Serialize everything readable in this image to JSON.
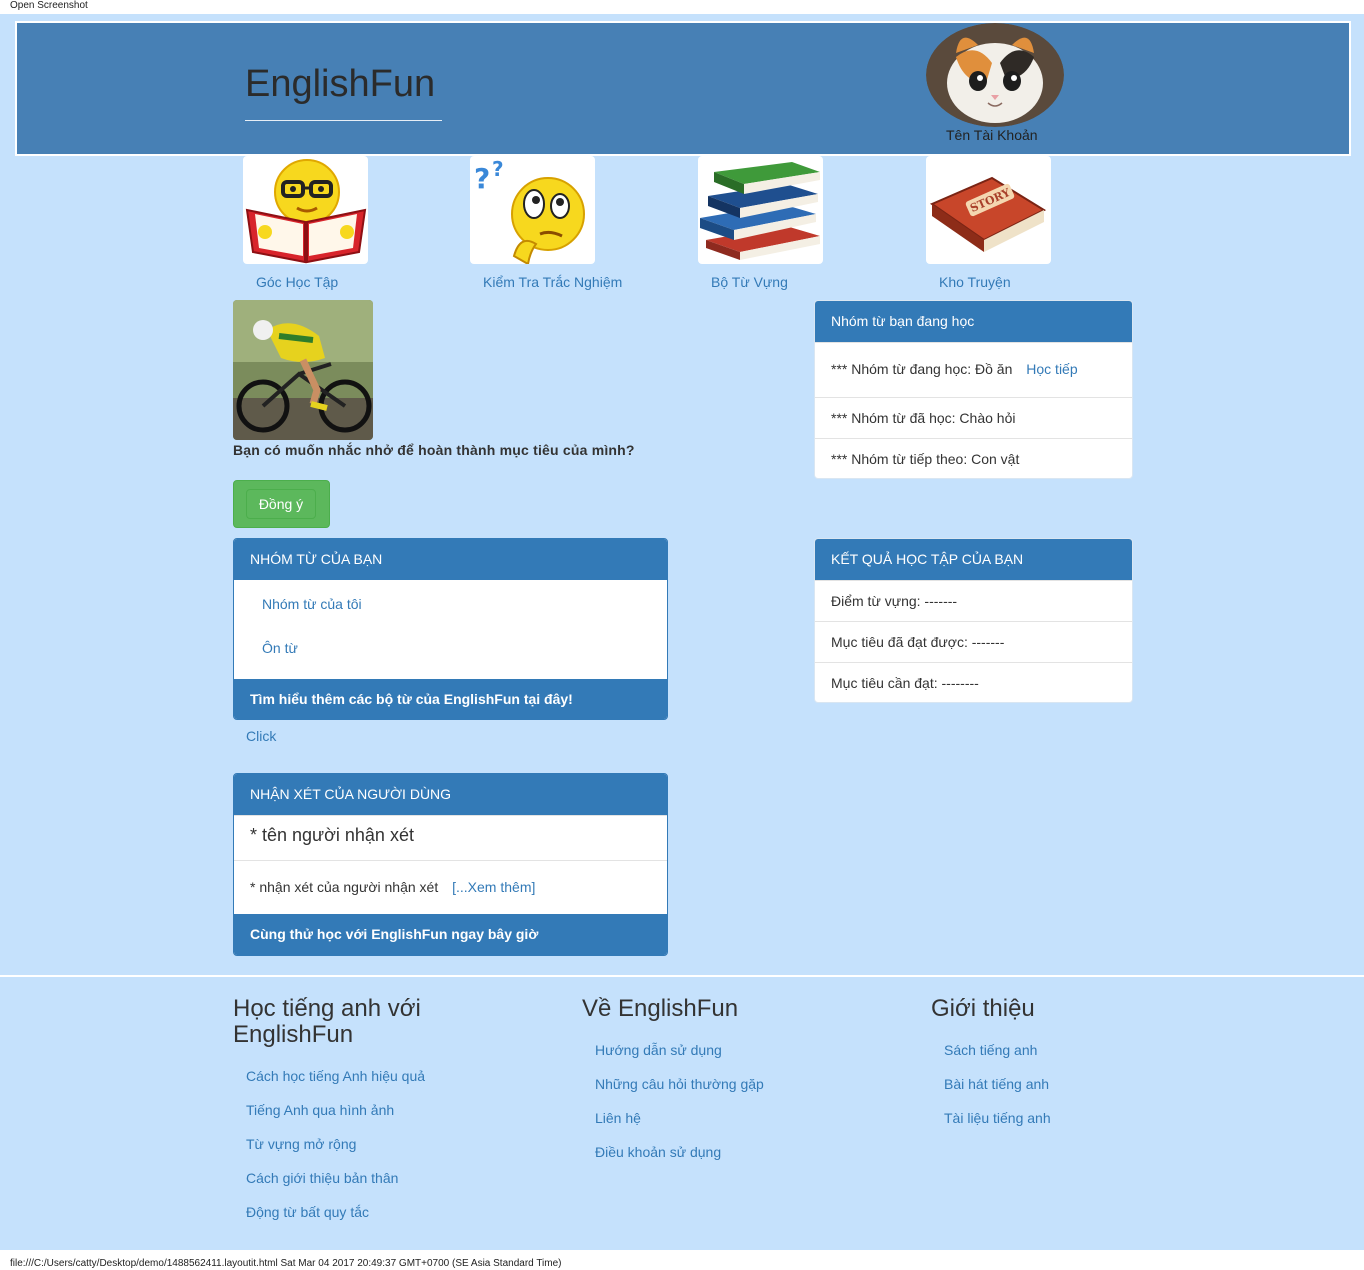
{
  "topbar": {
    "label": "Open Screenshot"
  },
  "header": {
    "brand": "EnglishFun",
    "account_name": "Tên Tài Khoản"
  },
  "nav": [
    {
      "label": "Góc Học Tập"
    },
    {
      "label": "Kiểm Tra Trắc Nghiệm"
    },
    {
      "label": "Bộ Từ Vựng"
    },
    {
      "label": "Kho Truyện"
    }
  ],
  "reminder": {
    "question": "Bạn có muốn nhắc nhở để hoàn thành mục tiêu của mình?",
    "agree_label": "Đồng ý"
  },
  "studying": {
    "title": "Nhóm từ bạn đang học",
    "current_prefix": "*** Nhóm từ đang học: Đồ ăn",
    "continue_link": "Học tiếp",
    "learned": "*** Nhóm từ đã học: Chào hỏi",
    "next": "*** Nhóm từ tiếp theo: Con vật"
  },
  "my_groups": {
    "title": "NHÓM TỪ CỦA BẠN",
    "items": [
      "Nhóm từ của tôi",
      "Ôn từ"
    ],
    "footer": "Tìm hiểu thêm các bộ từ của EnglishFun tại đây!",
    "click_link": "Click"
  },
  "results": {
    "title": "KẾT QUẢ HỌC TẬP CỦA BẠN",
    "rows": [
      "Điểm từ vựng: -------",
      "Mục tiêu đã đạt được: -------",
      "Mục tiêu cần đạt: --------"
    ]
  },
  "reviews": {
    "title": "NHẬN XÉT CỦA NGƯỜI DÙNG",
    "reviewer": "* tên người nhận xét",
    "comment": "* nhận xét của người nhận xét",
    "more_link": "[...Xem thêm]",
    "footer": "Cùng thử học với EnglishFun ngay bây giờ"
  },
  "footer": {
    "columns": [
      {
        "heading": "Học tiếng anh với EnglishFun",
        "items": [
          "Cách học tiếng Anh hiệu quả",
          "Tiếng Anh qua hình ảnh",
          "Từ vựng mở rộng",
          "Cách giới thiệu bản thân",
          "Động từ bất quy tắc"
        ]
      },
      {
        "heading": "Về EnglishFun",
        "items": [
          "Hướng dẫn sử dụng",
          "Những câu hỏi thường gặp",
          "Liên hệ",
          "Điều khoản sử dụng"
        ]
      },
      {
        "heading": "Giới thiệu",
        "items": [
          "Sách tiếng anh",
          "Bài hát tiếng anh",
          "Tài liệu tiếng anh"
        ]
      }
    ]
  },
  "statusbar": {
    "text": "file:///C:/Users/catty/Desktop/demo/1488562411.layoutit.html Sat Mar 04 2017 20:49:37 GMT+0700 (SE Asia Standard Time)"
  },
  "colors": {
    "header": "#4780b5",
    "page_bg": "#c5e1fc",
    "panel_head": "#337ab7",
    "link": "#337ab7",
    "agree": "#5cb85c"
  }
}
